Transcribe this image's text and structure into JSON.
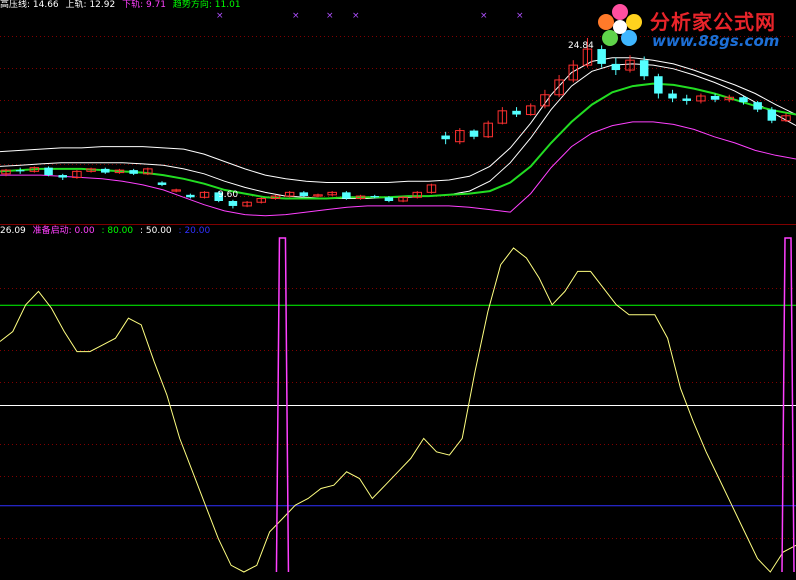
{
  "legend_top": {
    "items": [
      {
        "text": "高压线: 14.66",
        "color": "#ffffff"
      },
      {
        "text": "上轨: 12.92",
        "color": "#ffffff"
      },
      {
        "text": "下轨: 9.71",
        "color": "#ff40ff"
      },
      {
        "text": "趋势方向: 11.01",
        "color": "#00ff00"
      }
    ]
  },
  "legend_bottom": {
    "items": [
      {
        "text": "26.09",
        "color": "#ffffff"
      },
      {
        "text": "准备启动: 0.00",
        "color": "#ff40ff"
      },
      {
        "text": ": 80.00",
        "color": "#00ff00"
      },
      {
        "text": ": 50.00",
        "color": "#ffffff"
      },
      {
        "text": ": 20.00",
        "color": "#3030ff"
      }
    ]
  },
  "annotations": {
    "high_price": "24.84",
    "low_price": "9.60"
  },
  "watermark": {
    "line1": "分析家公式网",
    "line2": "www.88gs.com"
  },
  "colors": {
    "background": "#000000",
    "up_candle": "#ff3030",
    "down_candle": "#54ffff",
    "upper_band": "#ffffff",
    "high_line": "#ffffff",
    "lower_band": "#ff40ff",
    "trend": "#22dd22",
    "oscillator": "#ffff80",
    "ready_signal": "#ff40ff",
    "level_80": "#00ff00",
    "level_50": "#ffffff",
    "level_20": "#3030ff",
    "grid": "#800000"
  },
  "chart_data": [
    {
      "type": "candlestick",
      "title": "",
      "series": [
        {
          "name": "高压线",
          "values": [
            14.2,
            14.3,
            14.4,
            14.5,
            14.5,
            14.6,
            14.6,
            14.6,
            14.5,
            14.4,
            14.0,
            13.4,
            12.8,
            12.3,
            12.0,
            11.8,
            11.7,
            11.7,
            11.7,
            11.7,
            11.8,
            11.8,
            11.9,
            12.2,
            13.0,
            14.5,
            16.5,
            18.8,
            20.6,
            21.5,
            21.8,
            21.8,
            21.6,
            21.3,
            20.8,
            20.2,
            19.6,
            18.9,
            18.0,
            17.2
          ]
        },
        {
          "name": "上轨",
          "values": [
            13.0,
            13.1,
            13.2,
            13.3,
            13.3,
            13.3,
            13.3,
            13.2,
            13.1,
            12.8,
            12.4,
            11.8,
            11.3,
            10.9,
            10.6,
            10.5,
            10.4,
            10.4,
            10.4,
            10.5,
            10.5,
            10.6,
            10.7,
            11.0,
            11.8,
            13.3,
            15.3,
            17.6,
            19.5,
            20.7,
            21.2,
            21.3,
            21.2,
            20.9,
            20.4,
            19.8,
            19.1,
            18.2,
            17.2,
            16.3
          ]
        },
        {
          "name": "下轨",
          "values": [
            12.3,
            12.3,
            12.3,
            12.2,
            12.1,
            12.0,
            11.8,
            11.5,
            11.1,
            10.5,
            9.9,
            9.4,
            9.1,
            9.0,
            9.1,
            9.3,
            9.5,
            9.7,
            9.8,
            9.8,
            9.8,
            9.8,
            9.8,
            9.7,
            9.5,
            9.3,
            10.8,
            12.9,
            14.6,
            15.7,
            16.3,
            16.6,
            16.6,
            16.4,
            16.0,
            15.4,
            14.9,
            14.3,
            13.9,
            13.6
          ]
        },
        {
          "name": "趋势方向",
          "values": [
            12.6,
            12.7,
            12.8,
            12.8,
            12.8,
            12.7,
            12.6,
            12.5,
            12.3,
            12.0,
            11.6,
            11.1,
            10.8,
            10.5,
            10.4,
            10.4,
            10.4,
            10.5,
            10.5,
            10.5,
            10.6,
            10.6,
            10.7,
            10.8,
            11.0,
            11.7,
            13.0,
            14.9,
            16.6,
            18.0,
            19.0,
            19.5,
            19.7,
            19.6,
            19.3,
            18.9,
            18.4,
            17.9,
            17.5,
            17.2
          ]
        }
      ],
      "candles": [
        [
          12.4,
          12.7,
          12.2,
          12.8
        ],
        [
          12.7,
          12.6,
          12.4,
          12.9
        ],
        [
          12.6,
          12.9,
          12.5,
          13.0
        ],
        [
          12.9,
          12.3,
          12.2,
          13.0
        ],
        [
          12.3,
          12.1,
          11.9,
          12.4
        ],
        [
          12.1,
          12.6,
          12.0,
          12.7
        ],
        [
          12.6,
          12.8,
          12.5,
          12.9
        ],
        [
          12.8,
          12.5,
          12.4,
          12.9
        ],
        [
          12.5,
          12.7,
          12.4,
          12.8
        ],
        [
          12.7,
          12.4,
          12.3,
          12.8
        ],
        [
          12.4,
          12.8,
          12.3,
          12.9
        ],
        [
          11.7,
          11.5,
          11.4,
          11.8
        ],
        [
          11.0,
          11.1,
          10.9,
          11.2
        ],
        [
          10.7,
          10.5,
          10.4,
          10.8
        ],
        [
          10.5,
          10.9,
          10.4,
          11.0
        ],
        [
          10.9,
          10.2,
          10.1,
          11.0
        ],
        [
          10.2,
          9.8,
          9.6,
          10.3
        ],
        [
          9.8,
          10.1,
          9.7,
          10.2
        ],
        [
          10.1,
          10.4,
          10.0,
          10.5
        ],
        [
          10.4,
          10.6,
          10.3,
          10.7
        ],
        [
          10.6,
          10.9,
          10.5,
          11.0
        ],
        [
          10.9,
          10.6,
          10.5,
          11.0
        ],
        [
          10.6,
          10.7,
          10.5,
          10.8
        ],
        [
          10.7,
          10.9,
          10.6,
          11.0
        ],
        [
          10.9,
          10.4,
          10.3,
          11.0
        ],
        [
          10.4,
          10.6,
          10.3,
          10.7
        ],
        [
          10.6,
          10.5,
          10.4,
          10.7
        ],
        [
          10.5,
          10.2,
          10.1,
          10.6
        ],
        [
          10.2,
          10.5,
          10.1,
          10.6
        ],
        [
          10.5,
          10.9,
          10.4,
          11.0
        ],
        [
          10.9,
          11.5,
          10.8,
          11.6
        ],
        [
          15.5,
          15.2,
          14.8,
          15.8
        ],
        [
          15.0,
          15.9,
          14.8,
          16.1
        ],
        [
          15.9,
          15.4,
          15.2,
          16.0
        ],
        [
          15.4,
          16.5,
          15.3,
          16.7
        ],
        [
          16.5,
          17.5,
          16.4,
          17.8
        ],
        [
          17.5,
          17.2,
          17.0,
          17.8
        ],
        [
          17.2,
          17.9,
          17.1,
          18.1
        ],
        [
          17.9,
          18.8,
          17.7,
          19.2
        ],
        [
          18.8,
          20.0,
          18.6,
          20.4
        ],
        [
          20.0,
          21.2,
          19.8,
          21.6
        ],
        [
          21.2,
          22.5,
          21.0,
          23.4
        ],
        [
          22.5,
          21.3,
          21.0,
          22.8
        ],
        [
          21.3,
          20.8,
          20.4,
          21.8
        ],
        [
          20.8,
          21.6,
          20.6,
          22.0
        ],
        [
          21.6,
          20.3,
          20.0,
          21.9
        ],
        [
          20.3,
          18.9,
          18.5,
          20.5
        ],
        [
          18.9,
          18.5,
          18.2,
          19.2
        ],
        [
          18.5,
          18.3,
          18.0,
          18.8
        ],
        [
          18.3,
          18.7,
          18.1,
          18.9
        ],
        [
          18.7,
          18.4,
          18.2,
          18.9
        ],
        [
          18.4,
          18.6,
          18.2,
          18.8
        ],
        [
          18.6,
          18.2,
          18.0,
          18.7
        ],
        [
          18.2,
          17.6,
          17.4,
          18.3
        ],
        [
          17.6,
          16.7,
          16.5,
          17.8
        ],
        [
          16.7,
          17.1,
          16.6,
          17.3
        ]
      ]
    },
    {
      "type": "line",
      "title": "",
      "ylim": [
        0,
        100
      ],
      "levels": [
        80,
        50,
        20
      ],
      "series": [
        {
          "name": "oscillator",
          "values": [
            69,
            72,
            80,
            84,
            79,
            72,
            66,
            66,
            68,
            70,
            76,
            74,
            63,
            53,
            40,
            30,
            20,
            10,
            2,
            0,
            2,
            12,
            16,
            20,
            22,
            25,
            26,
            30,
            28,
            22,
            26,
            30,
            34,
            40,
            36,
            35,
            40,
            60,
            78,
            92,
            97,
            94,
            88,
            80,
            84,
            90,
            90,
            85,
            80,
            77,
            77,
            77,
            70,
            55,
            45,
            36,
            28,
            20,
            12,
            4,
            0,
            6,
            8
          ]
        },
        {
          "name": "准备启动",
          "values": [
            0,
            0,
            0,
            0,
            0,
            0,
            0,
            0,
            0,
            0,
            0,
            0,
            0,
            0,
            0,
            0,
            0,
            0,
            0,
            0,
            0,
            0,
            100,
            0,
            0,
            0,
            0,
            0,
            0,
            0,
            0,
            0,
            0,
            0,
            0,
            0,
            0,
            0,
            0,
            0,
            0,
            0,
            0,
            0,
            0,
            0,
            0,
            0,
            0,
            0,
            0,
            0,
            0,
            0,
            0,
            0,
            0,
            0,
            0,
            0,
            0,
            0,
            100
          ]
        }
      ]
    }
  ]
}
